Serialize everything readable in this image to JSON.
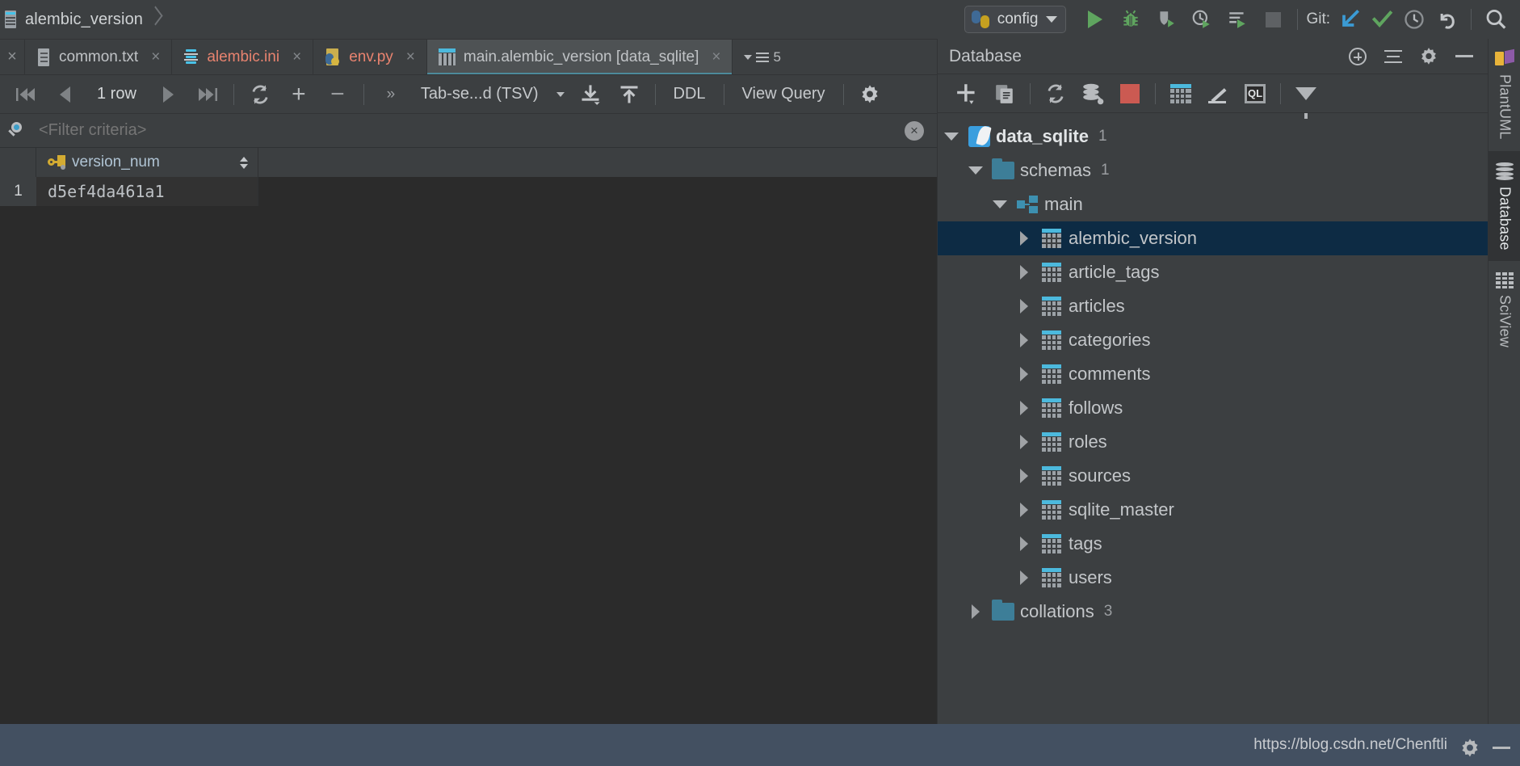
{
  "breadcrumb": {
    "icon": "file-icon",
    "label": "alembic_version"
  },
  "toolbar": {
    "run_config": {
      "label": "config",
      "icon": "python-icon"
    },
    "buttons": [
      {
        "name": "run-button",
        "icon": "run-icon"
      },
      {
        "name": "debug-button",
        "icon": "debug-bug-icon"
      },
      {
        "name": "run-coverage-button",
        "icon": "shield-run-icon"
      },
      {
        "name": "profile-button",
        "icon": "clock-run-icon"
      },
      {
        "name": "run-with-params-button",
        "icon": "list-run-icon"
      },
      {
        "name": "stop-button",
        "icon": "stop-square-icon"
      }
    ],
    "git_label": "Git:",
    "git_buttons": [
      {
        "name": "git-update-button",
        "icon": "arrow-down-left-icon"
      },
      {
        "name": "git-commit-button",
        "icon": "checkmark-icon"
      },
      {
        "name": "git-history-button",
        "icon": "clock-icon"
      },
      {
        "name": "git-rollback-button",
        "icon": "undo-icon"
      }
    ],
    "search_button": {
      "name": "search-everywhere-button",
      "icon": "magnifier-icon"
    }
  },
  "editor_tabs": {
    "close_all": "×",
    "tabs": [
      {
        "label": "common.txt",
        "icon": "txt-file-icon",
        "active": false,
        "modified": false
      },
      {
        "label": "alembic.ini",
        "icon": "ini-file-icon",
        "active": false,
        "modified": true
      },
      {
        "label": "env.py",
        "icon": "python-file-icon",
        "active": false,
        "modified": true
      },
      {
        "label": "main.alembic_version [data_sqlite]",
        "icon": "table-icon",
        "active": true,
        "modified": false
      }
    ],
    "overflow_count": "5",
    "close_glyph": "×"
  },
  "grid_toolbar": {
    "first_page": "first-page-icon",
    "prev_page": "prev-page-icon",
    "row_count": "1 row",
    "next_page": "next-page-icon",
    "last_page": "last-page-icon",
    "reload": "reload-icon",
    "add_row": "+",
    "delete_row": "−",
    "expand": "»",
    "format_label": "Tab-se...d (TSV)",
    "import": "import-icon",
    "export": "export-icon",
    "ddl_label": "DDL",
    "view_query_label": "View Query",
    "settings": "gear-icon"
  },
  "filter": {
    "icon": "filter-search-icon",
    "placeholder": "<Filter criteria>",
    "value": "",
    "clear_glyph": "×"
  },
  "grid": {
    "columns": [
      {
        "label": "version_num",
        "icon": "primary-key-icon",
        "sortable": true
      }
    ],
    "rows": [
      {
        "num": "1",
        "cells": [
          "d5ef4da461a1"
        ]
      }
    ]
  },
  "database_panel": {
    "title": "Database",
    "header_actions": [
      {
        "name": "add-data-source-button",
        "icon": "circle-plus-icon"
      },
      {
        "name": "collapse-all-button",
        "icon": "collapse-all-icon"
      },
      {
        "name": "settings-button",
        "icon": "gear-icon"
      },
      {
        "name": "hide-button",
        "icon": "minimize-icon"
      }
    ],
    "toolbar": [
      {
        "name": "new-button",
        "icon": "plus-icon"
      },
      {
        "name": "duplicate-button",
        "icon": "copy-icon"
      },
      {
        "name": "refresh-button",
        "icon": "refresh-icon"
      },
      {
        "name": "data-source-properties-button",
        "icon": "db-wrench-icon"
      },
      {
        "name": "stop-button",
        "icon": "red-square-icon"
      },
      {
        "name": "jump-to-table-button",
        "icon": "table-icon"
      },
      {
        "name": "modify-button",
        "icon": "pencil-icon"
      },
      {
        "name": "open-console-button",
        "icon": "sql-console-icon"
      },
      {
        "name": "filter-button",
        "icon": "funnel-icon"
      }
    ],
    "tree": [
      {
        "label": "data_sqlite",
        "count": "1",
        "icon": "sqlite-icon",
        "indent": 0,
        "expanded": true,
        "bold": true,
        "selected": false
      },
      {
        "label": "schemas",
        "count": "1",
        "icon": "folder-icon",
        "indent": 1,
        "expanded": true,
        "bold": false,
        "selected": false
      },
      {
        "label": "main",
        "count": "",
        "icon": "schema-icon",
        "indent": 2,
        "expanded": true,
        "bold": false,
        "selected": false
      },
      {
        "label": "alembic_version",
        "count": "",
        "icon": "table-icon",
        "indent": 3,
        "expanded": false,
        "bold": false,
        "selected": true
      },
      {
        "label": "article_tags",
        "count": "",
        "icon": "table-icon",
        "indent": 3,
        "expanded": false,
        "bold": false,
        "selected": false
      },
      {
        "label": "articles",
        "count": "",
        "icon": "table-icon",
        "indent": 3,
        "expanded": false,
        "bold": false,
        "selected": false
      },
      {
        "label": "categories",
        "count": "",
        "icon": "table-icon",
        "indent": 3,
        "expanded": false,
        "bold": false,
        "selected": false
      },
      {
        "label": "comments",
        "count": "",
        "icon": "table-icon",
        "indent": 3,
        "expanded": false,
        "bold": false,
        "selected": false
      },
      {
        "label": "follows",
        "count": "",
        "icon": "table-icon",
        "indent": 3,
        "expanded": false,
        "bold": false,
        "selected": false
      },
      {
        "label": "roles",
        "count": "",
        "icon": "table-icon",
        "indent": 3,
        "expanded": false,
        "bold": false,
        "selected": false
      },
      {
        "label": "sources",
        "count": "",
        "icon": "table-icon",
        "indent": 3,
        "expanded": false,
        "bold": false,
        "selected": false
      },
      {
        "label": "sqlite_master",
        "count": "",
        "icon": "table-icon",
        "indent": 3,
        "expanded": false,
        "bold": false,
        "selected": false
      },
      {
        "label": "tags",
        "count": "",
        "icon": "table-icon",
        "indent": 3,
        "expanded": false,
        "bold": false,
        "selected": false
      },
      {
        "label": "users",
        "count": "",
        "icon": "table-icon",
        "indent": 3,
        "expanded": false,
        "bold": false,
        "selected": false
      },
      {
        "label": "collations",
        "count": "3",
        "icon": "folder-icon",
        "indent": 1,
        "expanded": false,
        "bold": false,
        "selected": false
      }
    ]
  },
  "right_strip": [
    {
      "label": "PlantUML",
      "icon": "plantuml-icon",
      "active": false
    },
    {
      "label": "Database",
      "icon": "database-icon",
      "active": true
    },
    {
      "label": "SciView",
      "icon": "sciview-icon",
      "active": false
    }
  ],
  "statusbar": {
    "url": "https://blog.csdn.net/Chenftli",
    "gear": "gear-icon",
    "minimize": "minimize-icon"
  },
  "colors": {
    "accent_blue": "#4cb9dd",
    "selection": "#0d2b44",
    "panel_bg": "#3c3f41",
    "editor_bg": "#2b2b2b",
    "status_bg": "#435061",
    "run_green": "#5fa55f",
    "error_red": "#cb5a52",
    "tab_modified": "#e8836f"
  }
}
